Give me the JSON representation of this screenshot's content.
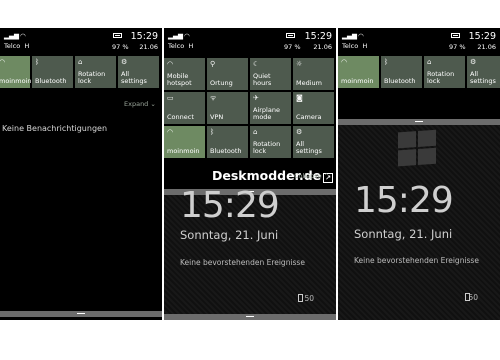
{
  "status": {
    "carrier": "Telco",
    "network": "H",
    "time": "15:29",
    "battery": "97 %",
    "date": "21.06"
  },
  "panel1": {
    "tiles": [
      {
        "label": "moinmoin",
        "icon": "wifi-icon",
        "active": true
      },
      {
        "label": "Bluetooth",
        "icon": "bluetooth-icon",
        "active": false
      },
      {
        "label": "Rotation lock",
        "icon": "rotation-lock-icon",
        "active": false
      },
      {
        "label": "All settings",
        "icon": "gear-icon",
        "active": false
      }
    ],
    "expand_label": "Expand",
    "notice": "Keine Benachrichtigungen"
  },
  "panel2": {
    "tiles": [
      {
        "label": "Mobile hotspot",
        "icon": "wifi-icon",
        "active": false
      },
      {
        "label": "Ortung",
        "icon": "location-icon",
        "active": false
      },
      {
        "label": "Quiet hours",
        "icon": "moon-icon",
        "active": false
      },
      {
        "label": "Medium",
        "icon": "brightness-icon",
        "active": false
      },
      {
        "label": "Connect",
        "icon": "connect-icon",
        "active": false
      },
      {
        "label": "VPN",
        "icon": "vpn-icon",
        "active": false
      },
      {
        "label": "Airplane mode",
        "icon": "airplane-icon",
        "active": false
      },
      {
        "label": "Camera",
        "icon": "camera-icon",
        "active": false
      },
      {
        "label": "moinmoin",
        "icon": "wifi-icon",
        "active": true
      },
      {
        "label": "Bluetooth",
        "icon": "bluetooth-icon",
        "active": false
      },
      {
        "label": "Rotation lock",
        "icon": "rotation-lock-icon",
        "active": false
      },
      {
        "label": "All settings",
        "icon": "gear-icon",
        "active": false
      }
    ],
    "watermark": "Deskmodder.de",
    "collapse_label": "Collapse"
  },
  "lock": {
    "time": "15:29",
    "day": "Sonntag, 21. Juni",
    "events": "Keine bevorstehenden Ereignisse",
    "battery": "50"
  }
}
